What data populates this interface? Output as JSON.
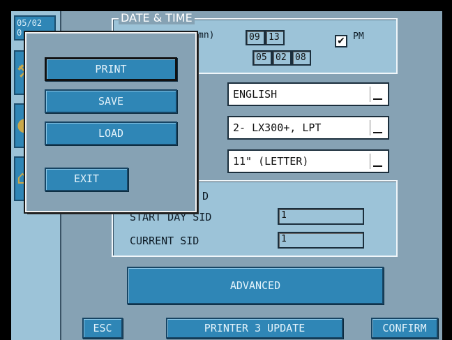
{
  "sidebar": {
    "date_line1": "05/02",
    "date_line2": "0"
  },
  "date_time": {
    "title": "DATE & TIME",
    "label_partial": "mn)",
    "hour": "09",
    "minute": "13",
    "pm_checked_mark": "✔",
    "pm_label": "PM",
    "month": "05",
    "day": "02",
    "year": "08"
  },
  "settings": {
    "language": "ENGLISH",
    "printer": "2- LX300+, LPT",
    "paper": "11\" (LETTER)"
  },
  "sid": {
    "title_partial": "D",
    "start_day_label": "START DAY SID",
    "start_day_value": "1",
    "current_label": "CURRENT SID",
    "current_value": "1"
  },
  "buttons": {
    "advanced": "ADVANCED",
    "esc": "ESC",
    "printer_update": "PRINTER 3 UPDATE",
    "confirm": "CONFIRM"
  },
  "popup": {
    "print": "PRINT",
    "save": "SAVE",
    "load": "LOAD",
    "exit": "EXIT"
  },
  "icons": [
    "wrench-icon",
    "globe-icon",
    "home-icon",
    "dropdown-arrow-icon",
    "check-icon"
  ],
  "colors": {
    "panel_bg": "#86a2b4",
    "button_bg": "#2f86b6",
    "sidebar_bg": "#9cc3d8"
  }
}
